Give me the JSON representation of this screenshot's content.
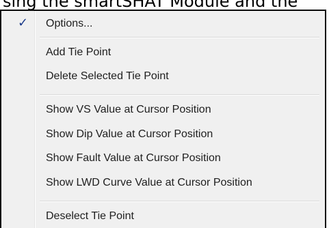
{
  "background_text": "sing the smartSHAT Module and the",
  "colors": {
    "menu_background": "#f0f0f0",
    "menu_border": "#0a0a0a",
    "text": "#1e1e1e",
    "check": "#1a3a8a"
  },
  "menu": {
    "options": {
      "label": "Options...",
      "checked": true,
      "check_icon": "✓"
    },
    "add_tie_point": {
      "label": "Add Tie Point"
    },
    "delete_selected_tie_point": {
      "label": "Delete Selected Tie Point"
    },
    "show_vs_value": {
      "label": "Show VS Value at Cursor Position"
    },
    "show_dip_value": {
      "label": "Show Dip Value at Cursor Position"
    },
    "show_fault_value": {
      "label": "Show Fault Value at Cursor Position"
    },
    "show_lwd_curve_value": {
      "label": "Show LWD Curve Value at Cursor Position"
    },
    "deselect_tie_point": {
      "label": "Deselect Tie Point"
    }
  }
}
